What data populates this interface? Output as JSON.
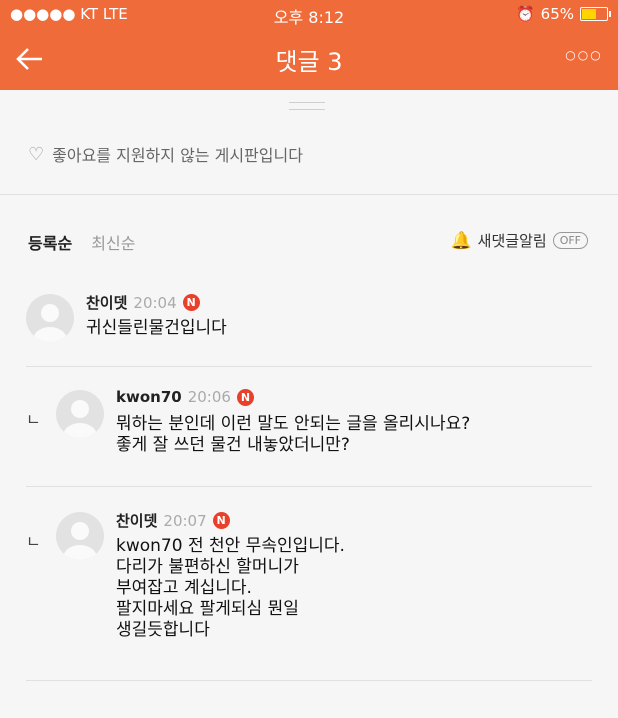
{
  "status_bar": {
    "carrier": "●●●●● KT  LTE",
    "time": "오후 8:12",
    "battery": "65%",
    "battery_level": 0.65
  },
  "header": {
    "title": "댓글 3",
    "back_icon": "back-arrow-icon",
    "more_icon": "more-dots-icon"
  },
  "notice": {
    "icon": "heart-outline-icon",
    "text": "좋아요를 지원하지 않는 게시판입니다"
  },
  "sort": {
    "options": [
      "등록순",
      "최신순"
    ],
    "selected": "등록순"
  },
  "alarm": {
    "label": "새댓글알림",
    "toggle": "OFF"
  },
  "comments": [
    {
      "author": "찬이뎃",
      "time": "20:04",
      "badge": "N",
      "is_reply": false,
      "lines": [
        "귀신들린물건입니다"
      ]
    },
    {
      "author": "kwon70",
      "time": "20:06",
      "badge": "N",
      "is_reply": true,
      "lines": [
        "뭐하는 분인데 이런 말도 안되는 글을 올리시나요?",
        "좋게 잘 쓰던 물건 내놓았더니만?"
      ]
    },
    {
      "author": "찬이뎃",
      "time": "20:07",
      "badge": "N",
      "is_reply": true,
      "lines": [
        "kwon70 전 천안 무속인입니다.",
        "다리가 불편하신 할머니가",
        "부여잡고 계십니다.",
        "팔지마세요 팔게되심 뭔일",
        "생길듯합니다"
      ]
    }
  ],
  "reply_mark": "ㄴ",
  "colors": {
    "accent": "#ef6b3a",
    "badge": "#e8402a",
    "background": "#f6f6f6"
  }
}
